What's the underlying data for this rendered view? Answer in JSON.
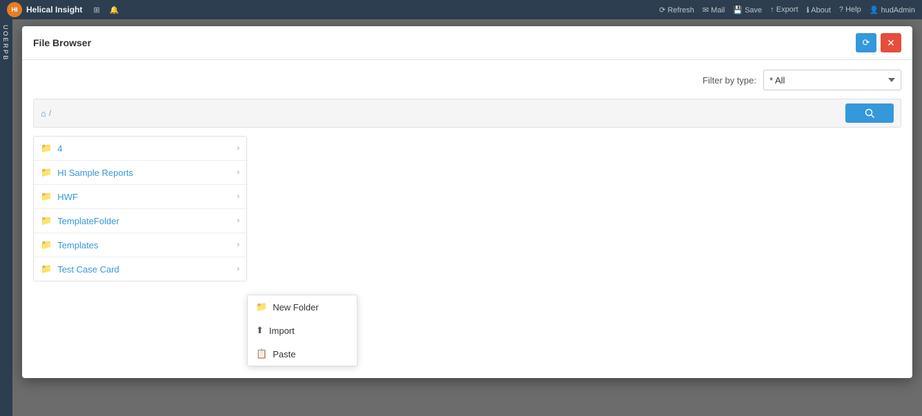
{
  "topbar": {
    "brand": "Helical Insight",
    "nav_items": [
      "grid-icon",
      "bell-icon"
    ],
    "actions": [
      "Refresh",
      "Mail",
      "Save",
      "Export",
      "About",
      "Help",
      "hudAdmin"
    ]
  },
  "modal": {
    "title": "File Browser",
    "refresh_label": "⟳",
    "close_label": "✕"
  },
  "filter": {
    "label": "Filter by type:",
    "options": [
      "All"
    ],
    "selected": "All",
    "placeholder": "* All"
  },
  "breadcrumb": {
    "home_icon": "⌂",
    "separator": "/"
  },
  "search_btn": "🔍",
  "file_list": {
    "items": [
      {
        "name": "4"
      },
      {
        "name": "HI Sample Reports"
      },
      {
        "name": "HWF"
      },
      {
        "name": "TemplateFolder"
      },
      {
        "name": "Templates"
      },
      {
        "name": "Test Case Card"
      }
    ]
  },
  "context_menu": {
    "items": [
      {
        "label": "New Folder",
        "icon": "folder"
      },
      {
        "label": "Import",
        "icon": "upload"
      },
      {
        "label": "Paste",
        "icon": "paste"
      }
    ]
  }
}
